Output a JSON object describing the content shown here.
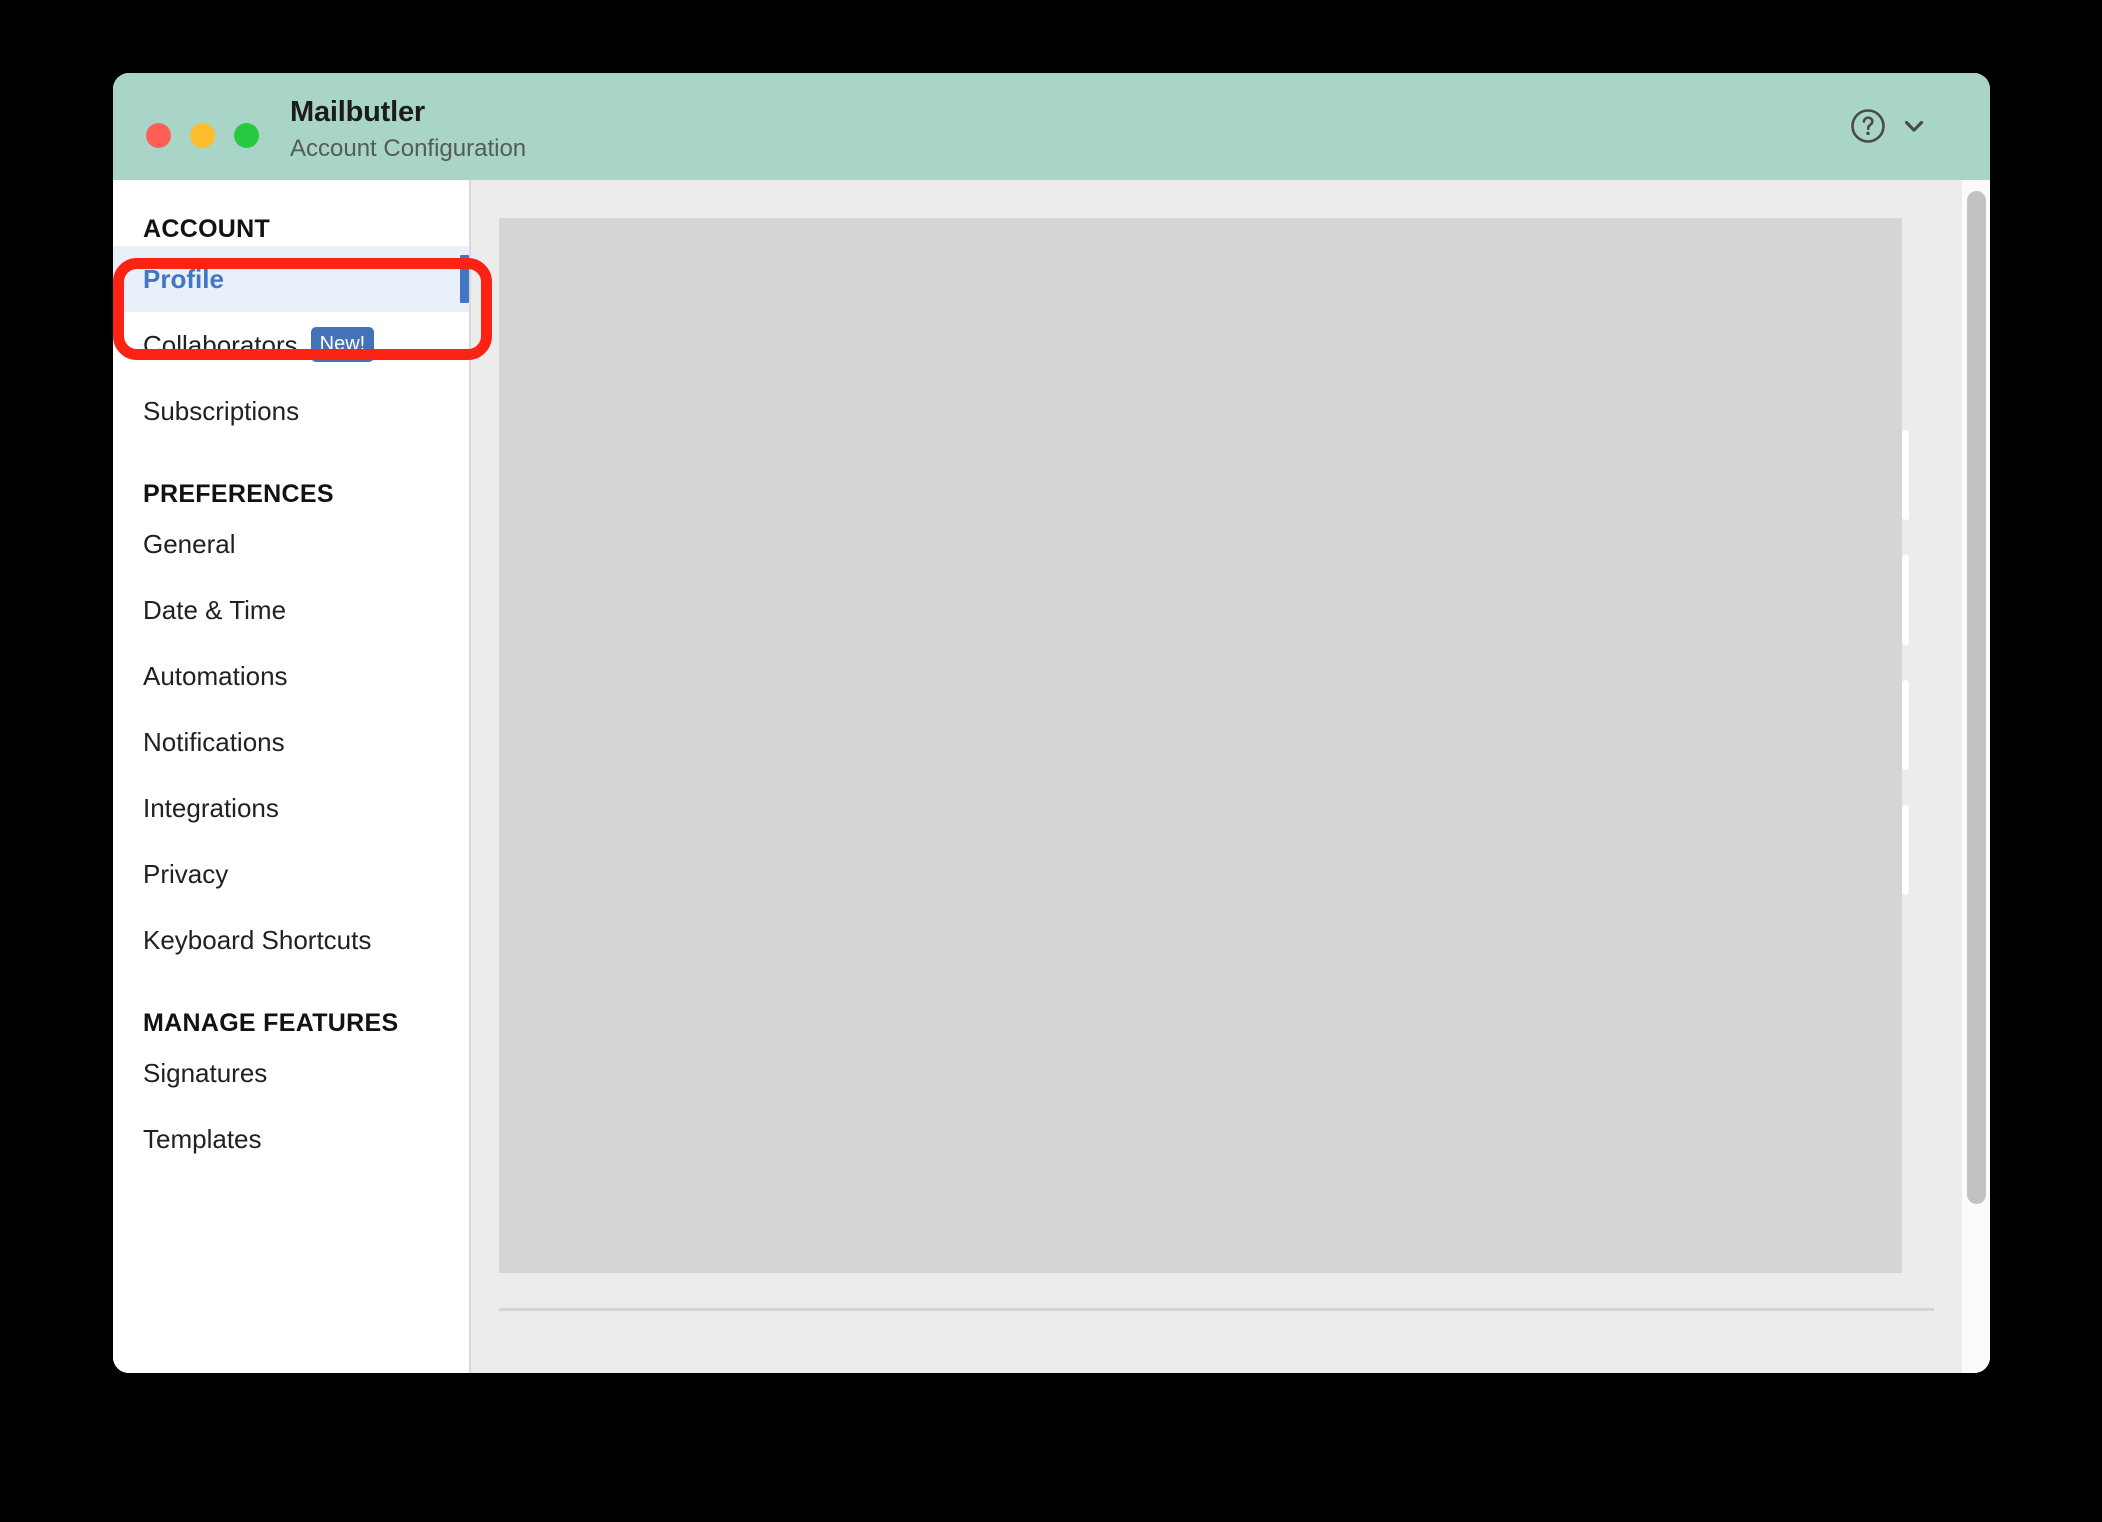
{
  "window": {
    "title": "Mailbutler",
    "subtitle": "Account Configuration",
    "traffic_lights": {
      "close_color": "#ff5f57",
      "minimize_color": "#febc2e",
      "maximize_color": "#28c840"
    },
    "titlebar_color": "#a8d5c8"
  },
  "titlebar_actions": {
    "help_icon": "question-circle-icon",
    "chevron_icon": "chevron-down-icon"
  },
  "sidebar": {
    "sections": [
      {
        "title": "ACCOUNT",
        "items": [
          {
            "label": "Profile",
            "active": true,
            "badge": null
          },
          {
            "label": "Collaborators",
            "active": false,
            "badge": "New!"
          },
          {
            "label": "Subscriptions",
            "active": false,
            "badge": null
          }
        ]
      },
      {
        "title": "PREFERENCES",
        "items": [
          {
            "label": "General",
            "active": false,
            "badge": null
          },
          {
            "label": "Date & Time",
            "active": false,
            "badge": null
          },
          {
            "label": "Automations",
            "active": false,
            "badge": null
          },
          {
            "label": "Notifications",
            "active": false,
            "badge": null
          },
          {
            "label": "Integrations",
            "active": false,
            "badge": null
          },
          {
            "label": "Privacy",
            "active": false,
            "badge": null
          },
          {
            "label": "Keyboard Shortcuts",
            "active": false,
            "badge": null
          }
        ]
      },
      {
        "title": "MANAGE FEATURES",
        "items": [
          {
            "label": "Signatures",
            "active": false,
            "badge": null
          },
          {
            "label": "Templates",
            "active": false,
            "badge": null
          }
        ]
      }
    ],
    "active_item_label": "Profile",
    "active_accent_color": "#4076c4",
    "active_background_color": "#eaf0fa",
    "badge_color": "#4472b8"
  },
  "content": {
    "panel_color": "#d5d5d5",
    "background_color": "#ececec",
    "edge_tab_count": 4,
    "scrollbar_thumb_color": "#c2c2c2"
  },
  "annotation": {
    "target_label": "Profile",
    "color": "#fa2314",
    "shape": "rounded-rectangle"
  }
}
